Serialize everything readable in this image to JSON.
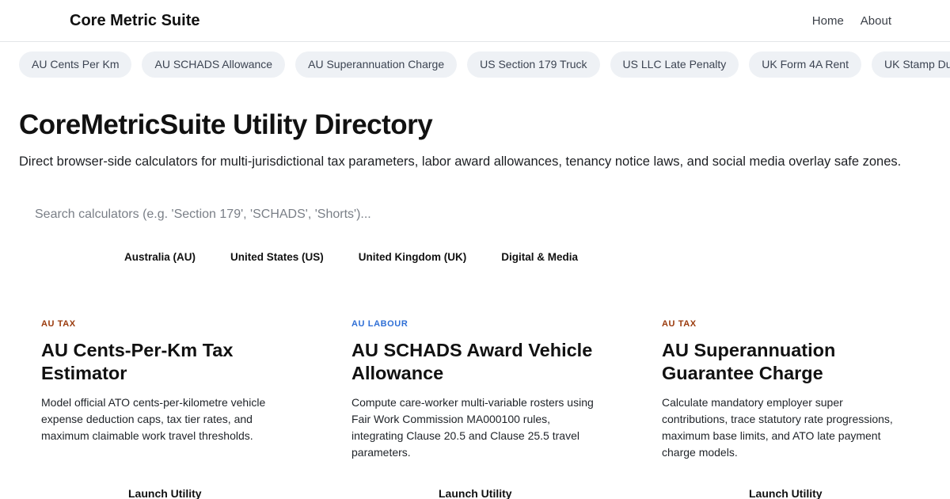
{
  "header": {
    "brand": "Core Metric Suite",
    "nav": [
      "Home",
      "About"
    ]
  },
  "chips": [
    "AU Cents Per Km",
    "AU SCHADS Allowance",
    "AU Superannuation Charge",
    "US Section 179 Truck",
    "US LLC Late Penalty",
    "UK Form 4A Rent",
    "UK Stamp Duty SD"
  ],
  "hero": {
    "title": "CoreMetricSuite Utility Directory",
    "subtitle": "Direct browser-side calculators for multi-jurisdictional tax parameters, labor award allowances, tenancy notice laws, and social media overlay safe zones."
  },
  "search": {
    "placeholder": "Search calculators (e.g. 'Section 179', 'SCHADS', 'Shorts')...",
    "value": ""
  },
  "filters": [
    "Australia (AU)",
    "United States (US)",
    "United Kingdom (UK)",
    "Digital & Media"
  ],
  "cards": [
    {
      "tag": "AU TAX",
      "title": "AU Cents-Per-Km Tax Estimator",
      "description": "Model official ATO cents-per-kilometre vehicle expense deduction caps, tax tier rates, and maximum claimable work travel thresholds.",
      "button": "Launch Utility"
    },
    {
      "tag": "AU LABOUR",
      "title": "AU SCHADS Award Vehicle Allowance",
      "description": "Compute care-worker multi-variable rosters using Fair Work Commission MA000100 rules, integrating Clause 20.5 and Clause 25.5 travel parameters.",
      "button": "Launch Utility"
    },
    {
      "tag": "AU TAX",
      "title": "AU Superannuation Guarantee Charge",
      "description": "Calculate mandatory employer super contributions, trace statutory rate progressions, maximum base limits, and ATO late payment charge models.",
      "button": "Launch Utility"
    }
  ],
  "colors": {
    "tag_tax": "#9a3a0c",
    "tag_labour": "#2f6fd6",
    "chip_bg": "#eef1f5",
    "border": "#e3e5e8"
  }
}
